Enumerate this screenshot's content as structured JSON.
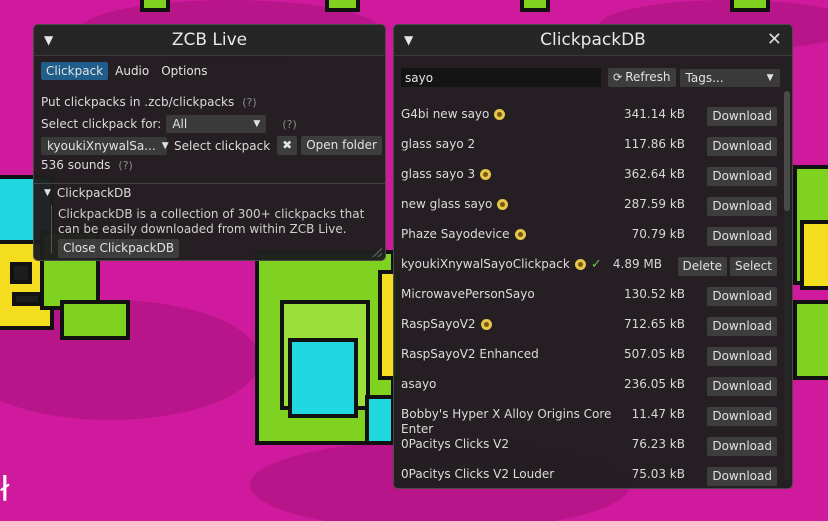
{
  "zcb": {
    "title": "ZCB Live",
    "tabs": [
      {
        "label": "Clickpack",
        "active": true
      },
      {
        "label": "Audio",
        "active": false
      },
      {
        "label": "Options",
        "active": false
      }
    ],
    "put_text": "Put clickpacks in .zcb/clickpacks",
    "help": "(?)",
    "select_for_label": "Select clickpack for:",
    "select_for_value": "All",
    "clickpack_value": "kyoukiXnywalSa...",
    "select_clickpack_label": "Select clickpack",
    "clear_label": "✖",
    "open_folder_label": "Open folder",
    "sounds_count": "536 sounds",
    "db_header": "ClickpackDB",
    "db_desc": "ClickpackDB is a collection of 300+ clickpacks that can be easily downloaded from within ZCB Live.",
    "close_db_label": "Close ClickpackDB"
  },
  "clickpackdb": {
    "title": "ClickpackDB",
    "search_value": "sayo",
    "refresh_label": "Refresh",
    "tags_label": "Tags...",
    "items": [
      {
        "name": "G4bi new sayo",
        "size": "341.14 kB",
        "badge": true,
        "installed": false,
        "action": "Download"
      },
      {
        "name": "glass sayo 2",
        "size": "117.86 kB",
        "badge": false,
        "installed": false,
        "action": "Download"
      },
      {
        "name": "glass sayo 3",
        "size": "362.64 kB",
        "badge": true,
        "installed": false,
        "action": "Download"
      },
      {
        "name": "new glass sayo",
        "size": "287.59 kB",
        "badge": true,
        "installed": false,
        "action": "Download"
      },
      {
        "name": "Phaze Sayodevice",
        "size": "70.79 kB",
        "badge": true,
        "installed": false,
        "action": "Download"
      },
      {
        "name": "kyoukiXnywalSayoClickpack",
        "size": "4.89 MB",
        "badge": true,
        "installed": true,
        "action": "Delete",
        "action2": "Select"
      },
      {
        "name": "MicrowavePersonSayo",
        "size": "130.52 kB",
        "badge": false,
        "installed": false,
        "action": "Download"
      },
      {
        "name": "RaspSayoV2",
        "size": "712.65 kB",
        "badge": true,
        "installed": false,
        "action": "Download"
      },
      {
        "name": "RaspSayoV2 Enhanced",
        "size": "507.05 kB",
        "badge": false,
        "installed": false,
        "action": "Download"
      },
      {
        "name": "asayo",
        "size": "236.05 kB",
        "badge": false,
        "installed": false,
        "action": "Download"
      },
      {
        "name": "Bobby's Hyper X Alloy Origins Core Enter",
        "size": "11.47 kB",
        "badge": false,
        "installed": false,
        "action": "Download"
      },
      {
        "name": "0Pacitys Clicks V2",
        "size": "76.23 kB",
        "badge": false,
        "installed": false,
        "action": "Download"
      },
      {
        "name": "0Pacitys Clicks V2 Louder",
        "size": "75.03 kB",
        "badge": false,
        "installed": false,
        "action": "Download"
      }
    ]
  },
  "colors": {
    "background": "#d01a9e",
    "accent_tab": "#1f5d8a",
    "installed_check": "#63c24f"
  }
}
